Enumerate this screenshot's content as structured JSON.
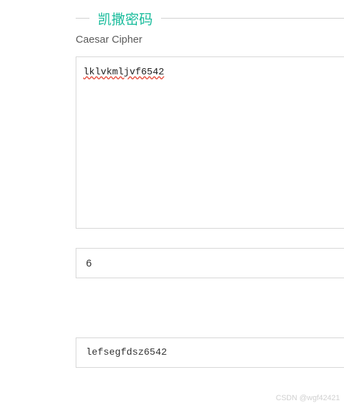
{
  "header": {
    "title": "凯撒密码",
    "subtitle": "Caesar Cipher"
  },
  "input": {
    "ciphertext": "lklvkmljvf6542",
    "shift": "6"
  },
  "output": {
    "plaintext": "lefsegfdsz6542"
  },
  "watermark": {
    "text": "CSDN @wgf42421"
  }
}
